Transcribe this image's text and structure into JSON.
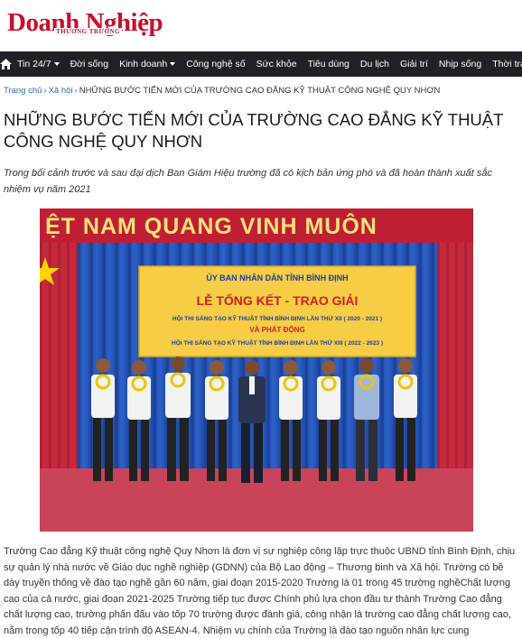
{
  "logo": {
    "main": "Doanh Nghiệp",
    "sub": "THƯƠNG TRƯỜNG"
  },
  "nav": {
    "items": [
      {
        "label": "Tin 24/7",
        "dropdown": true
      },
      {
        "label": "Đời sống",
        "dropdown": false
      },
      {
        "label": "Kinh doanh",
        "dropdown": true
      },
      {
        "label": "Công nghệ số",
        "dropdown": false
      },
      {
        "label": "Sức khỏe",
        "dropdown": false
      },
      {
        "label": "Tiêu dùng",
        "dropdown": false
      },
      {
        "label": "Du lịch",
        "dropdown": false
      },
      {
        "label": "Giải trí",
        "dropdown": false
      },
      {
        "label": "Nhịp sống",
        "dropdown": false
      },
      {
        "label": "Thời trang",
        "dropdown": false
      }
    ]
  },
  "breadcrumb": {
    "home": "Trang chủ",
    "section": "Xã hội",
    "current": "NHỮNG BƯỚC TIẾN MỚI CỦA TRƯỜNG CAO ĐẲNG KỸ THUẬT CÔNG NGHỆ QUY NHƠN"
  },
  "article": {
    "title": "NHỮNG BƯỚC TIẾN MỚI CỦA TRƯỜNG CAO ĐẲNG KỸ THUẬT CÔNG NGHỆ QUY NHƠN",
    "sapo": "Trong bối cảnh trước và sau đại dịch Ban Giám Hiệu trường đã có kịch bản ứng phó và đã hoàn thành xuất sắc nhiệm vụ năm 2021",
    "photo": {
      "banner_top": "ỆT NAM QUANG VINH MUÔN",
      "board_line1": "ỦY BAN NHÂN DÂN TỈNH BÌNH ĐỊNH",
      "board_line2": "LỄ TỔNG KẾT - TRAO GIẢI",
      "board_line3": "HỘI THI SÁNG TẠO KỸ THUẬT TỈNH BÌNH ĐỊNH LẦN THỨ XII ( 2020 - 2021 )",
      "board_line4": "VÀ PHÁT ĐỘNG",
      "board_line5": "HỘI THI SÁNG TẠO KỸ THUẬT TỈNH BÌNH ĐỊNH LẦN THỨ XIII ( 2022 - 2023 )"
    },
    "body": "Trường Cao đẳng Kỹ thuật công nghệ Quy Nhơn là đơn vị sự nghiệp công lập trực thuộc UBND tỉnh Bình Định, chịu sự quản lý nhà nước về Giáo dục nghề nghiệp (GDNN) của Bộ Lao động – Thương binh và Xã hội. Trường có bề dày truyền thống về đào tạo nghề gần 60 năm, giai đoạn 2015-2020 Trường là 01 trong 45 trường nghềChất lượng cao của cả nước, giai đoạn 2021-2025 Trường tiếp tục được Chính phủ lựa chọn đầu tư thành Trường Cao đẳng chất lượng cao, trường phấn đấu vào tốp 70 trường được đánh giá, công nhận là trường cao đẳng chất lượng cao, nằm trong tốp 40 tiếp cận trình độ ASEAN-4. Nhiệm vụ chính của Trường là đào tạo nguồn nhân lực cung"
  },
  "colors": {
    "brand": "#c8102e",
    "nav_bg": "#1f2126",
    "link": "#2a6fb0"
  }
}
